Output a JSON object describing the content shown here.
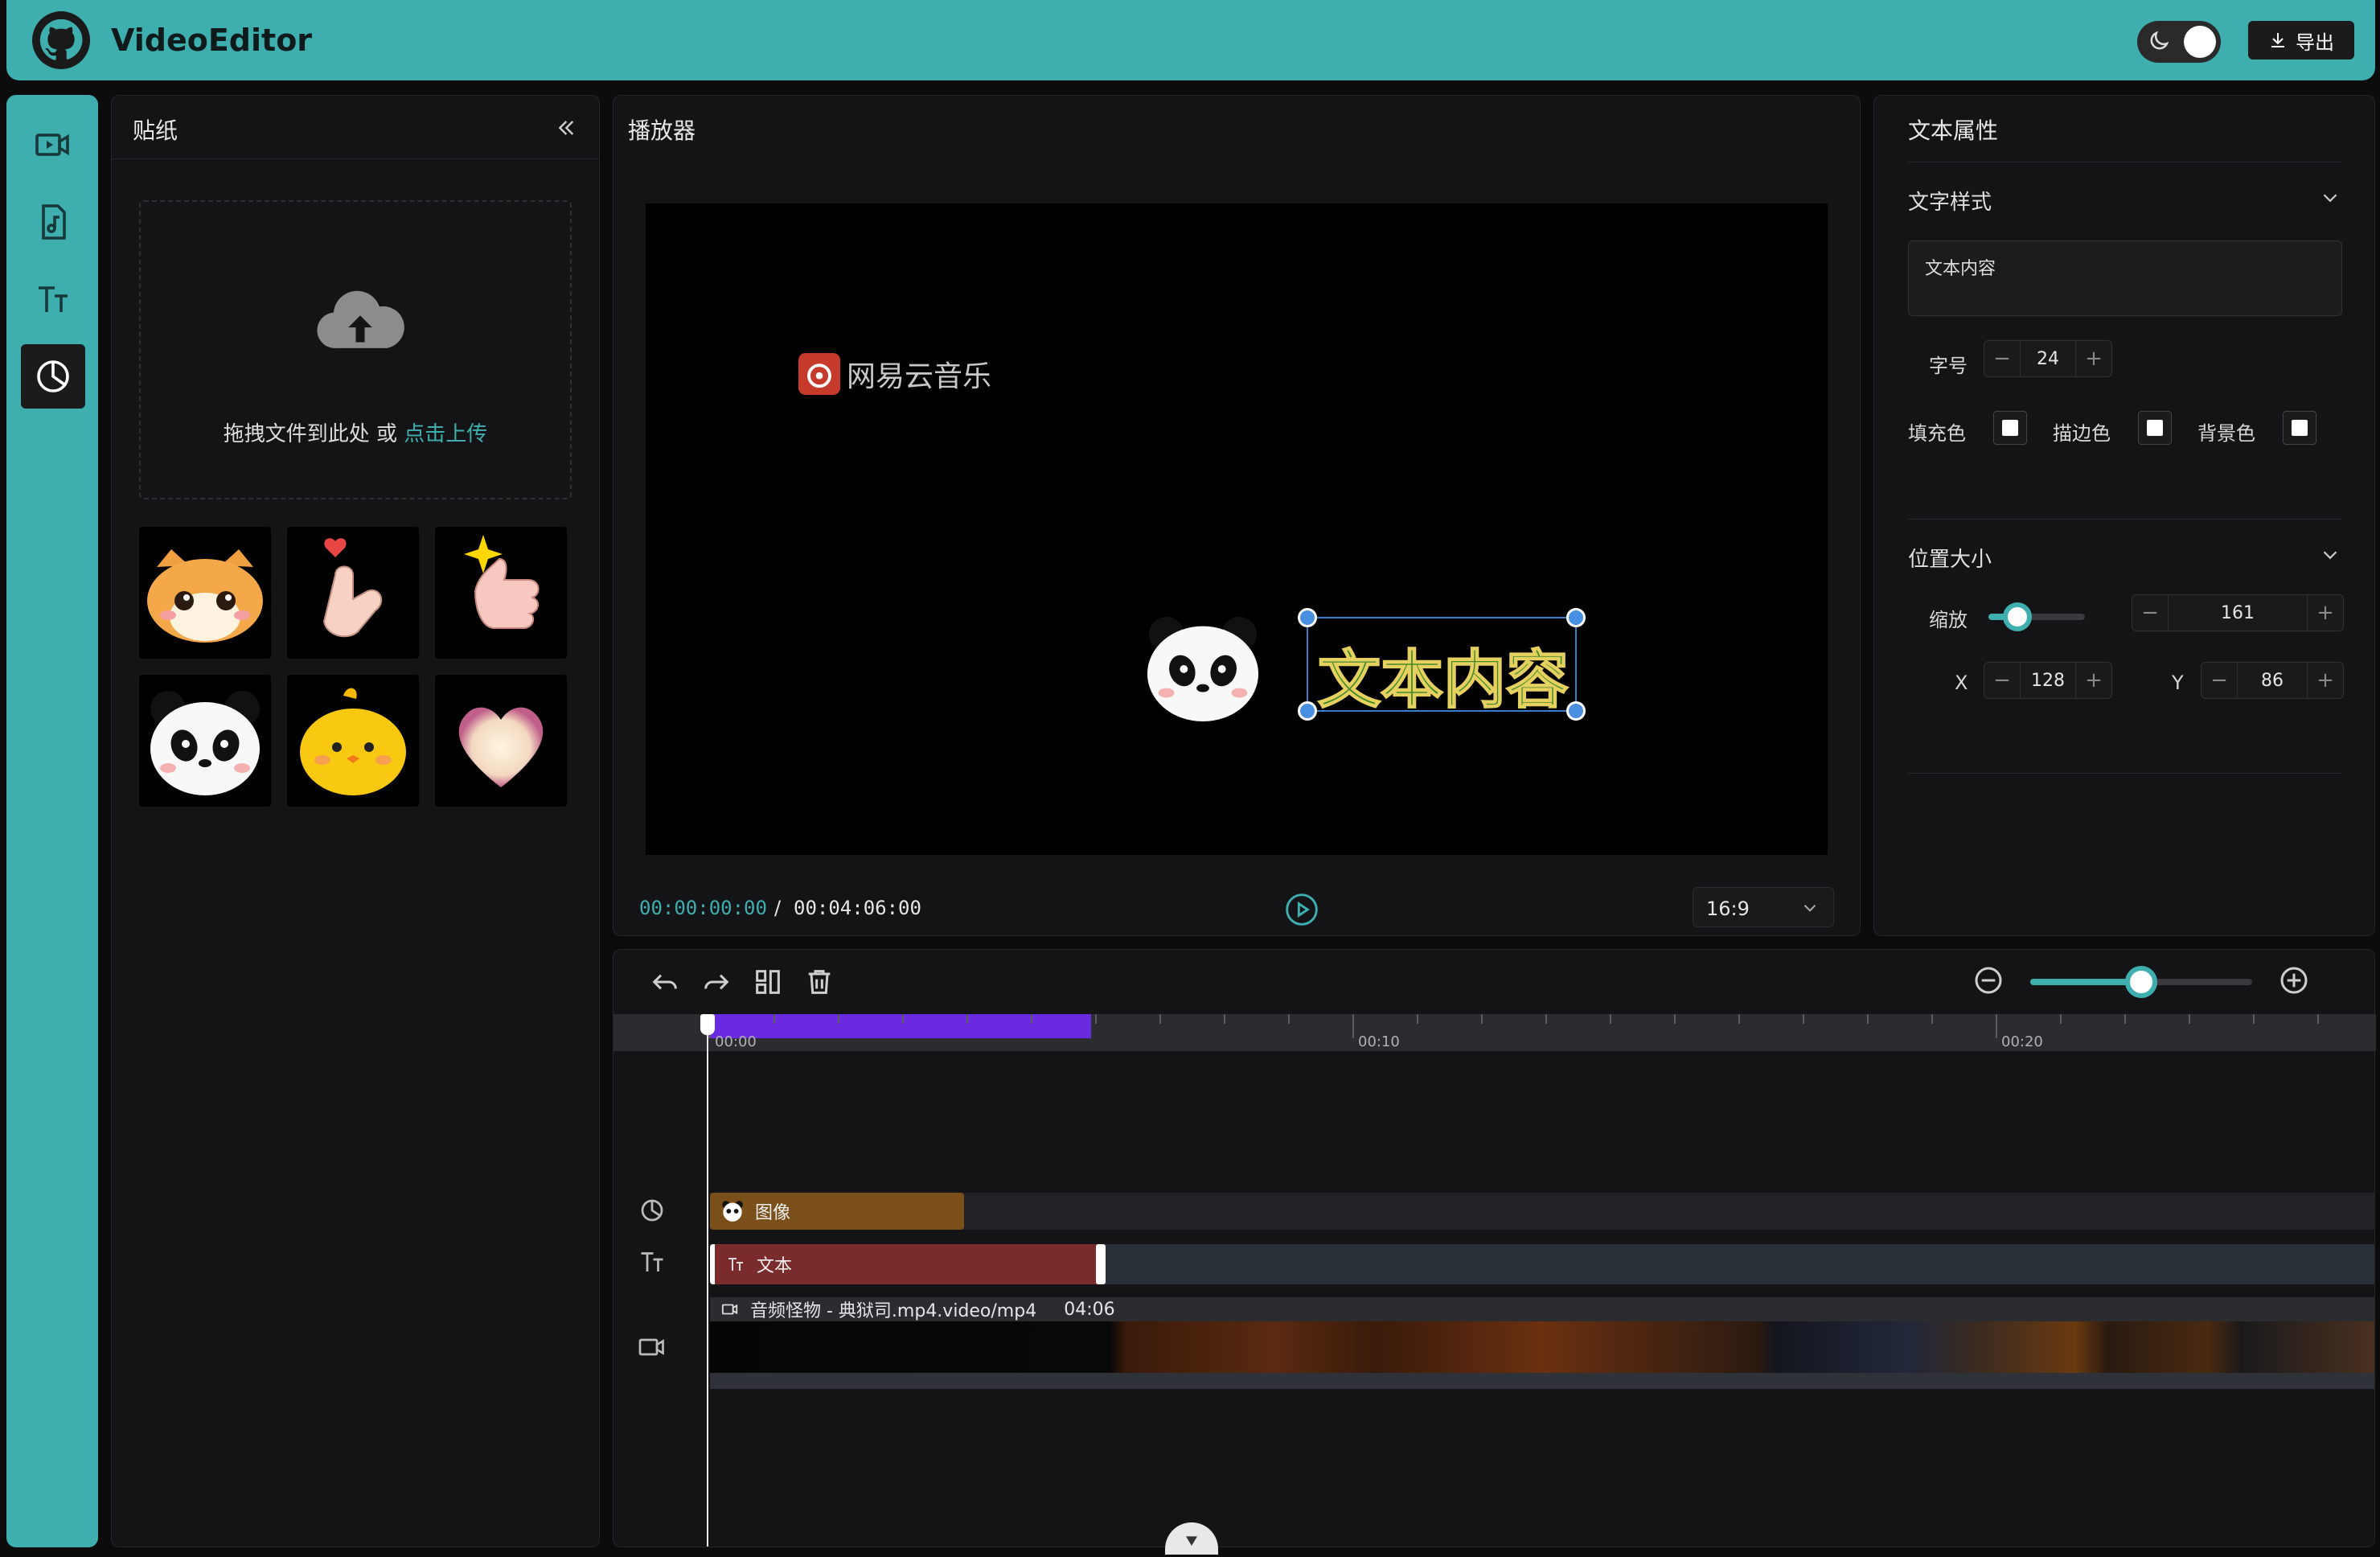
{
  "header": {
    "app_title": "VideoEditor",
    "export_label": "导出",
    "theme": "dark"
  },
  "rail": {
    "items": [
      "video-icon",
      "audio-icon",
      "text-icon",
      "sticker-icon"
    ],
    "active": "sticker-icon"
  },
  "sticker_panel": {
    "title": "贴纸",
    "upload_text": "拖拽文件到此处 或 ",
    "upload_link": "点击上传",
    "stickers": [
      "cat",
      "finger-heart",
      "thumbs-up",
      "panda",
      "chick",
      "glow-heart"
    ]
  },
  "player": {
    "title": "播放器",
    "watermark": "网易云音乐",
    "overlay_text": "文本内容",
    "time_current": "00:00:00:00",
    "time_separator": "/",
    "time_total": "00:04:06:00",
    "ratio": "16:9"
  },
  "props": {
    "title": "文本属性",
    "text_style_section": "文字样式",
    "text_content": "文本内容",
    "font_size_label": "字号",
    "font_size": "24",
    "fill_label": "填充色",
    "stroke_label": "描边色",
    "bg_label": "背景色",
    "position_section": "位置大小",
    "scale_label": "缩放",
    "scale": "161",
    "scale_slider_fraction": 0.3,
    "x_label": "X",
    "x": "128",
    "y_label": "Y",
    "y": "86"
  },
  "timeline": {
    "ticks": [
      "00:00",
      "00:10",
      "00:20"
    ],
    "zoom_fraction": 0.5,
    "tracks": {
      "image_label": "图像",
      "text_label": "文本",
      "video_label": "音频怪物 - 典狱司.mp4.video/mp4",
      "video_duration": "04:06"
    }
  },
  "colors": {
    "accent": "#3eaeaf",
    "image_clip": "#7a4f1a",
    "text_clip": "#7a2c2c",
    "selection_bar": "#6a2be0"
  }
}
